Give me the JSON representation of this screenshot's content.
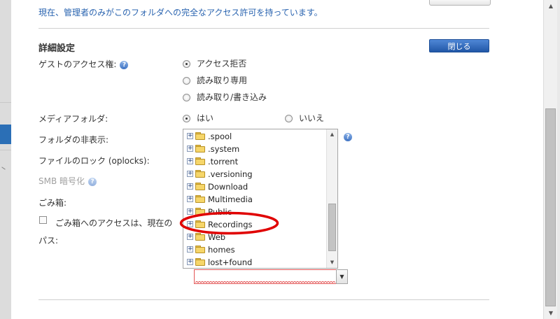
{
  "notice": "現在、管理者のみがこのフォルダへの完全なアクセス許可を持っています。",
  "section_title": "詳細設定",
  "close_button": "閉じる",
  "labels": {
    "guest_access": "ゲストのアクセス権:",
    "media_folder": "メディアフォルダ:",
    "hide_folder": "フォルダの非表示:",
    "file_lock": "ファイルのロック (oplocks):",
    "smb_encryption": "SMB 暗号化",
    "recycle_bin": "ごみ箱:",
    "recycle_access": "ごみ箱へのアクセスは、現在の",
    "path": "パス:"
  },
  "guest_options": [
    {
      "label": "アクセス拒否",
      "checked": true
    },
    {
      "label": "読み取り専用",
      "checked": false
    },
    {
      "label": "読み取り/書き込み",
      "checked": false
    }
  ],
  "media_options": [
    {
      "label": "はい",
      "checked": true
    },
    {
      "label": "いいえ",
      "checked": false
    }
  ],
  "help_glyph": "?",
  "folders": [
    ".spool",
    ".system",
    ".torrent",
    ".versioning",
    "Download",
    "Multimedia",
    "Public",
    "Recordings",
    "Web",
    "homes",
    "lost+found"
  ],
  "tree_scroll_fraction": 0.55,
  "path_value": "",
  "colors": {
    "accent_blue": "#2157a7",
    "notice_blue": "#2a64b0",
    "highlight_red": "#e00000",
    "folder_yellow": "#f6d66a"
  },
  "icons": {
    "help": "question-circle-icon",
    "folder": "folder-icon",
    "expander": "plus-box-icon",
    "dropdown": "chevron-down-icon"
  }
}
